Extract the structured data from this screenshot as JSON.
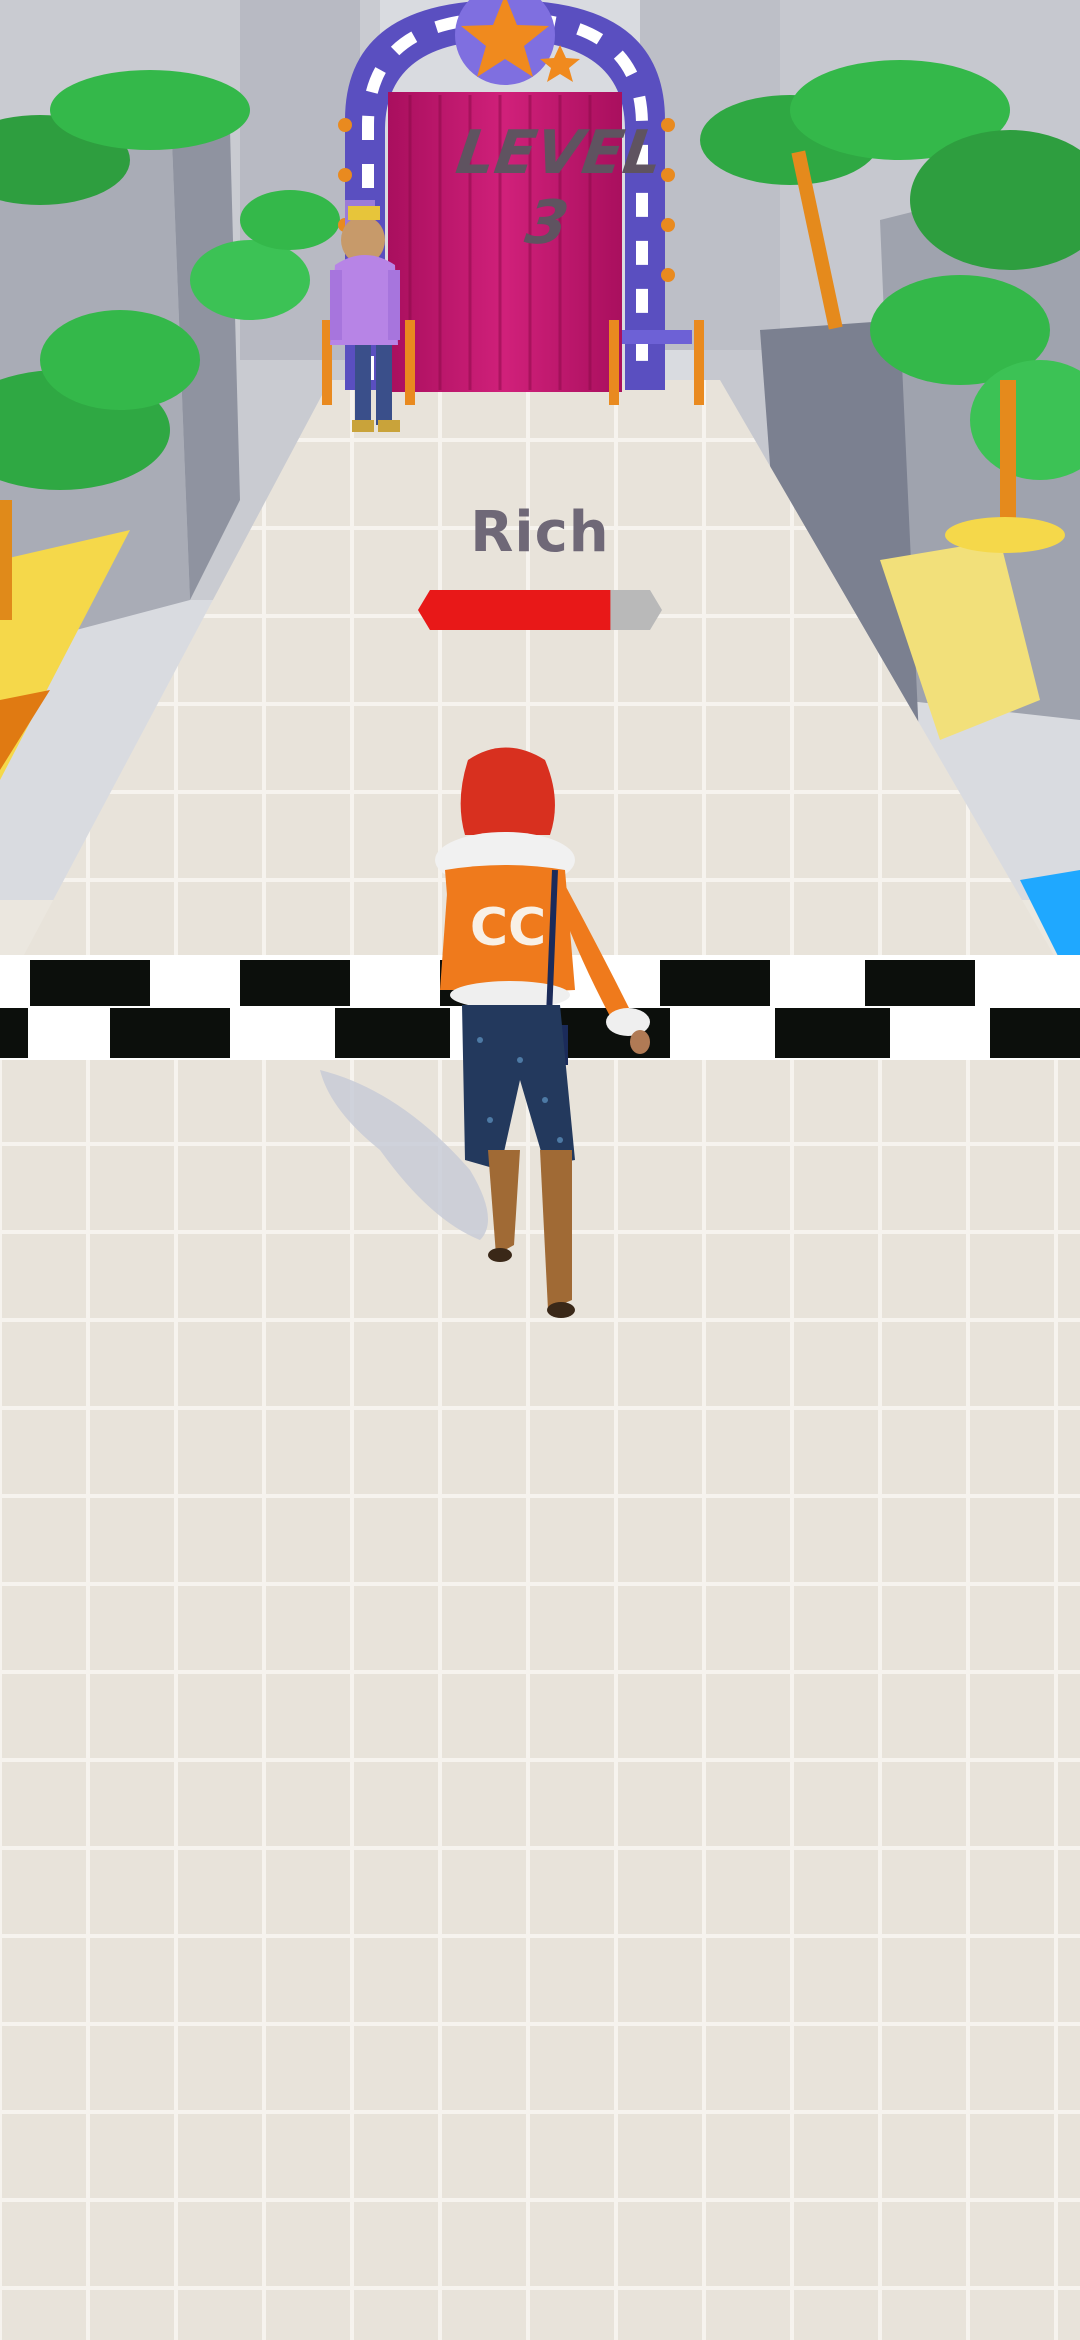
{
  "hud": {
    "status_label": "Rich",
    "wealth_progress": 0.82,
    "progress_fill_color": "#e81818",
    "progress_track_color": "#b9b9b9"
  },
  "gate": {
    "text": "LEVEL 3",
    "icon": "star-icon"
  },
  "colors": {
    "floor": "#ebe7df",
    "curtain": "#c0156e",
    "arch_blue": "#5a4fc0",
    "palm_green": "#33b947"
  }
}
